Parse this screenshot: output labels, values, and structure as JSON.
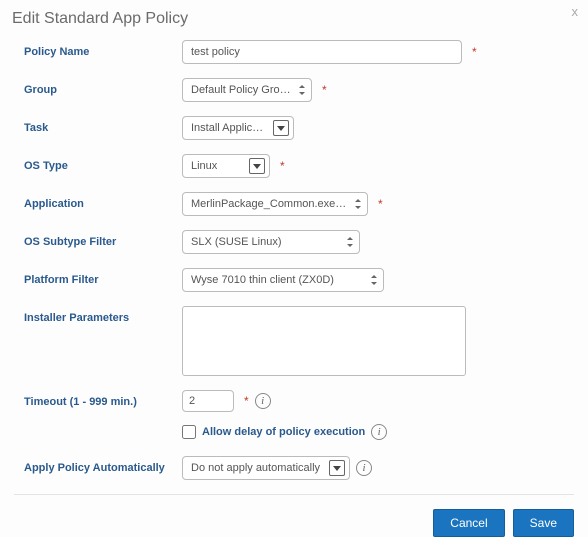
{
  "dialog": {
    "title": "Edit Standard App Policy",
    "close": "x"
  },
  "labels": {
    "policyName": "Policy Name",
    "group": "Group",
    "task": "Task",
    "osType": "OS Type",
    "application": "Application",
    "osSubtypeFilter": "OS Subtype Filter",
    "platformFilter": "Platform Filter",
    "installerParameters": "Installer Parameters",
    "timeout": "Timeout (1 - 999 min.)",
    "allowDelay": "Allow delay of policy execution",
    "applyAuto": "Apply Policy Automatically"
  },
  "values": {
    "policyName": "test policy",
    "group": "Default Policy Group",
    "task": "Install Application",
    "osType": "Linux",
    "application": "MerlinPackage_Common.exe (Loc",
    "osSubtypeFilter": "SLX (SUSE Linux)",
    "platformFilter": "Wyse 7010 thin client (ZX0D)",
    "installerParameters": "",
    "timeout": "2",
    "allowDelayChecked": false,
    "applyAuto": "Do not apply automatically"
  },
  "required": "*",
  "footer": {
    "cancel": "Cancel",
    "save": "Save"
  }
}
